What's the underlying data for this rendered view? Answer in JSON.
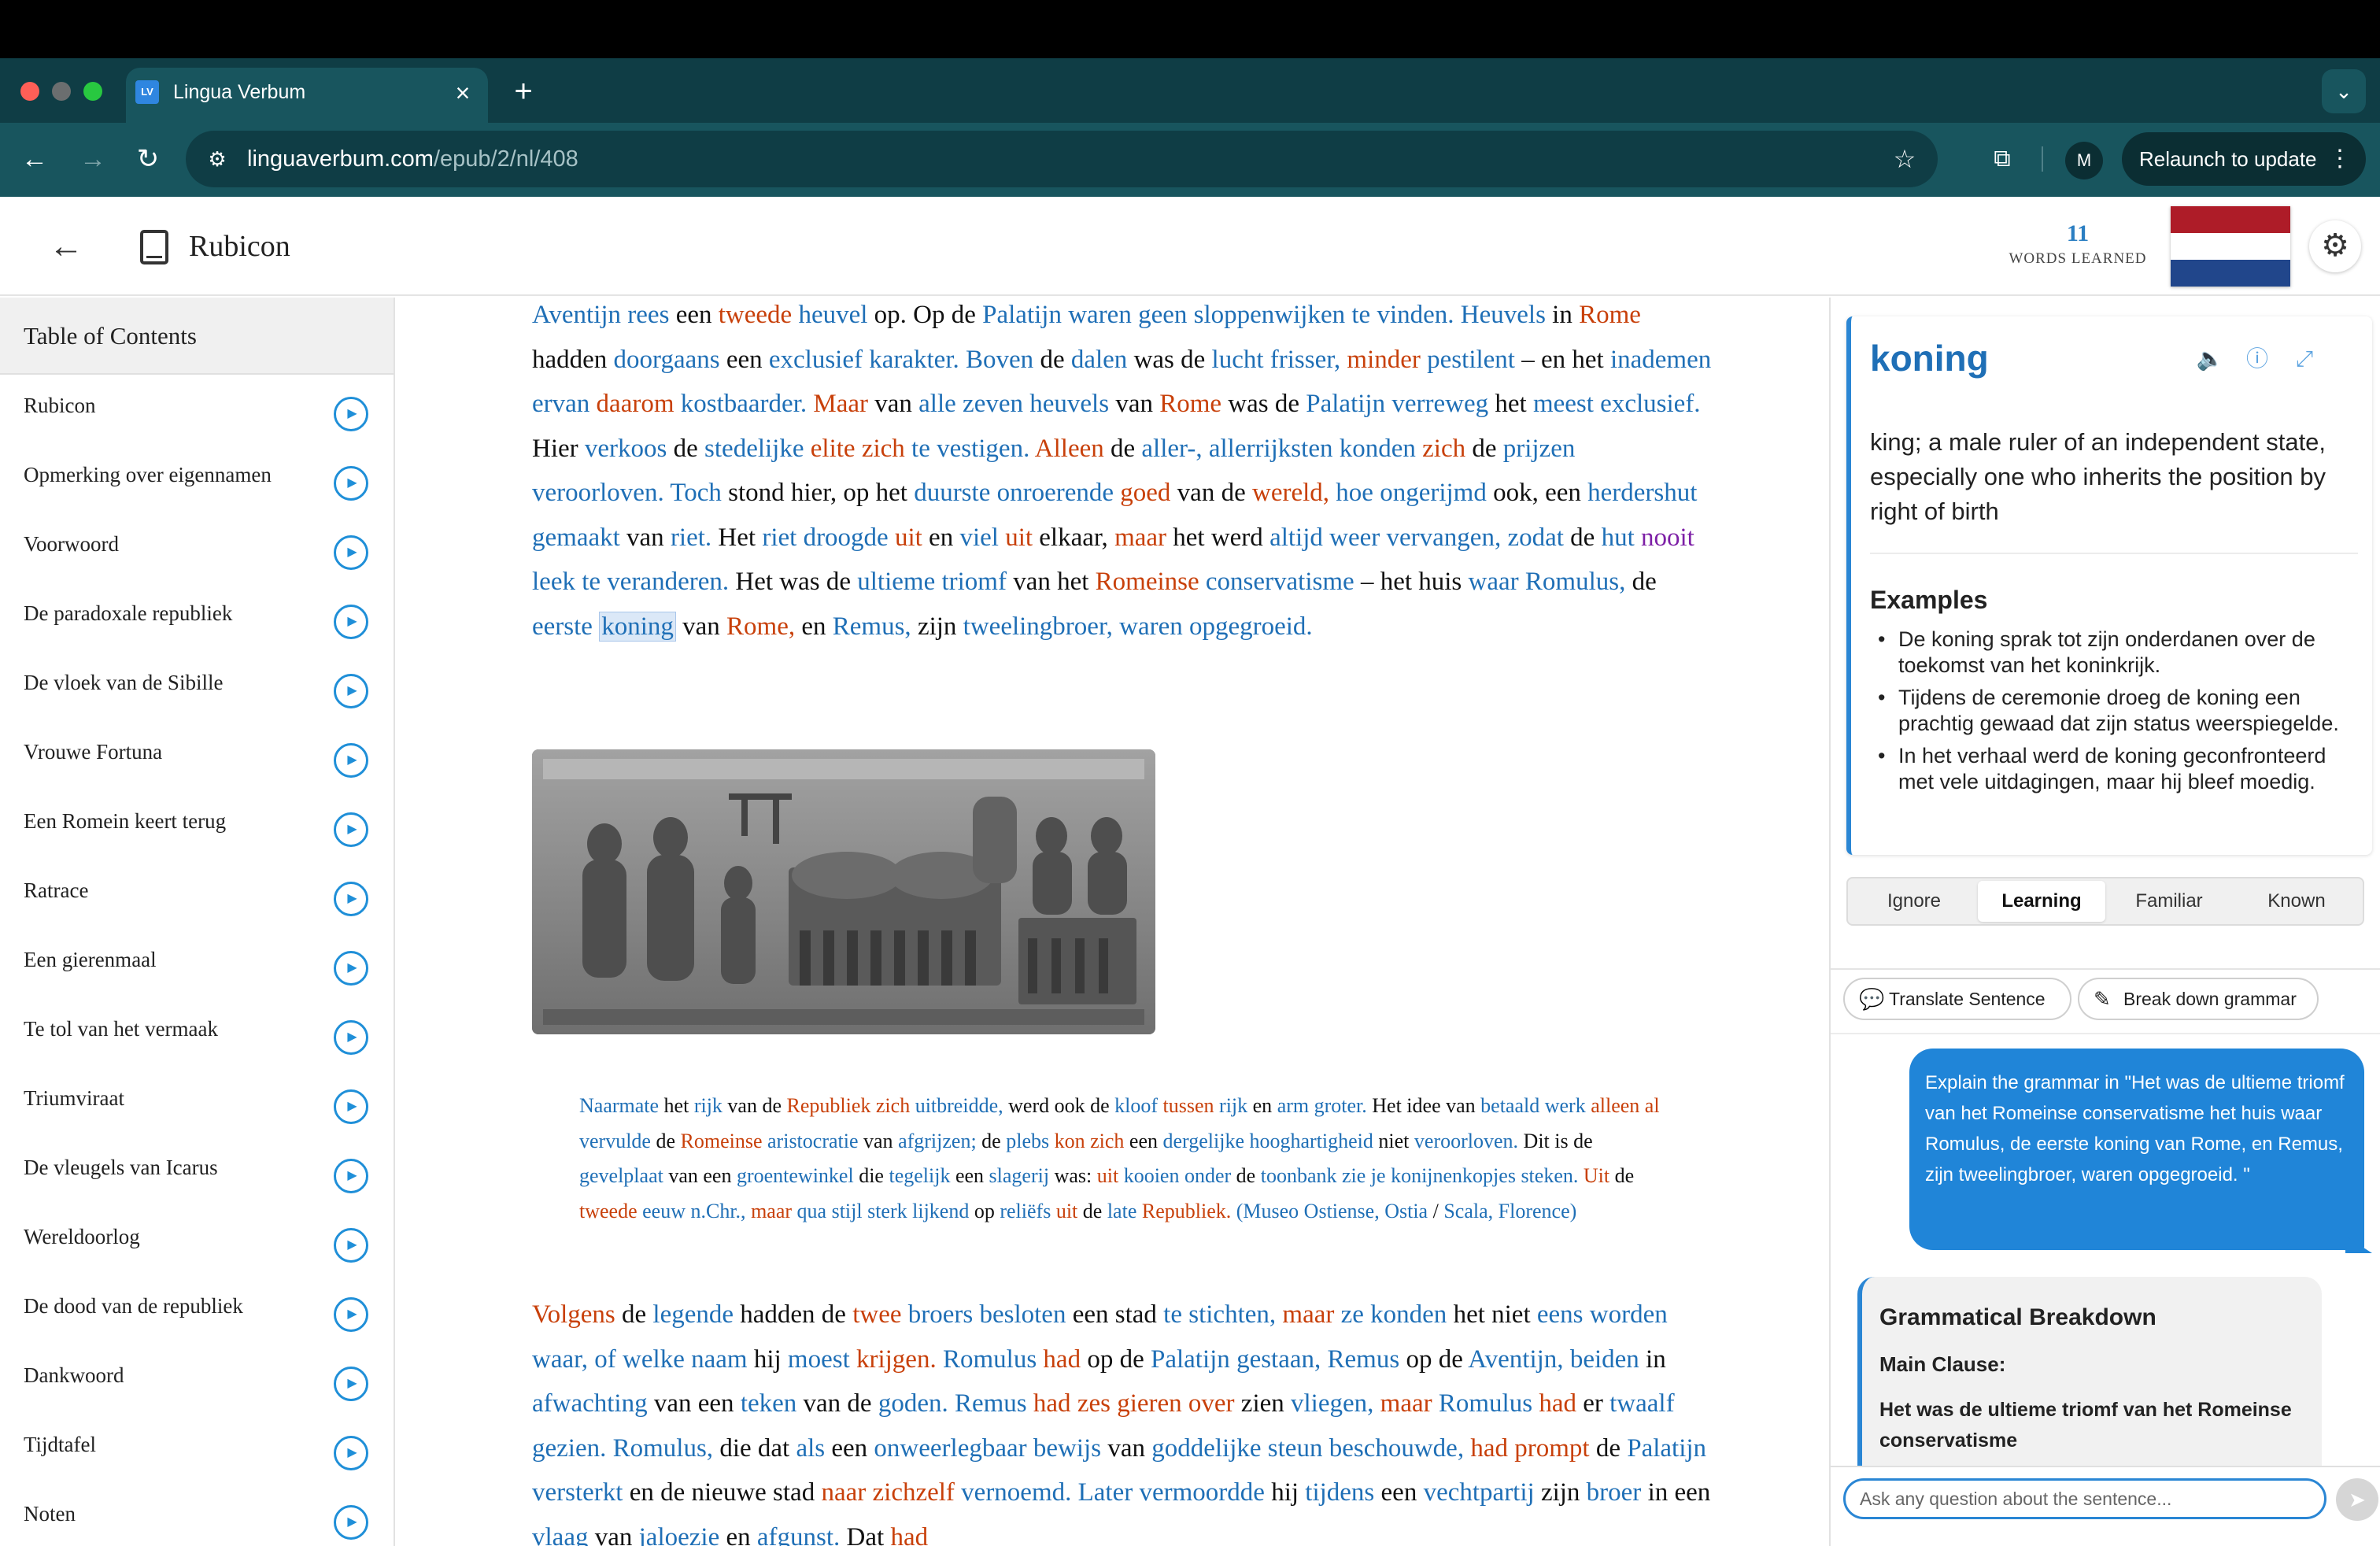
{
  "browser": {
    "tab_title": "Lingua Verbum",
    "tab_favicon": "LV",
    "url_domain": "linguaverbum.com",
    "url_path": "/epub/2/nl/408",
    "profile_initial": "M",
    "relaunch_label": "Relaunch to update"
  },
  "app": {
    "book_title": "Rubicon",
    "words_learned_count": "11",
    "words_learned_label": "WORDS LEARNED",
    "flag_colors": [
      "#ae1c28",
      "#ffffff",
      "#21468b"
    ]
  },
  "toc": {
    "title": "Table of Contents",
    "items": [
      "Rubicon",
      "Opmerking over eigennamen",
      "Voorwoord",
      "De paradoxale republiek",
      "De vloek van de Sibille",
      "Vrouwe Fortuna",
      "Een Romein keert terug",
      "Ratrace",
      "Een gierenmaal",
      "Te tol van het vermaak",
      "Triumviraat",
      "De vleugels van Icarus",
      "Wereldoorlog",
      "De dood van de republiek",
      "Dankwoord",
      "Tijdtafel",
      "Noten"
    ]
  },
  "reader": {
    "para1": [
      [
        "Aventijn",
        "b"
      ],
      [
        " "
      ],
      [
        "rees",
        "b"
      ],
      [
        " een "
      ],
      [
        "tweede",
        "r"
      ],
      [
        " "
      ],
      [
        "heuvel",
        "b"
      ],
      [
        " op. Op de "
      ],
      [
        "Palatijn",
        "b"
      ],
      [
        " "
      ],
      [
        "waren",
        "b"
      ],
      [
        " "
      ],
      [
        "geen",
        "b"
      ],
      [
        " "
      ],
      [
        "sloppenwijken",
        "b"
      ],
      [
        " "
      ],
      [
        "te",
        "b"
      ],
      [
        " "
      ],
      [
        "vinden.",
        "b"
      ],
      [
        " "
      ],
      [
        "Heuvels",
        "b"
      ],
      [
        " in "
      ],
      [
        "Rome",
        "r"
      ],
      [
        " hadden "
      ],
      [
        "doorgaans",
        "b"
      ],
      [
        " een "
      ],
      [
        "exclusief",
        "b"
      ],
      [
        " "
      ],
      [
        "karakter.",
        "b"
      ],
      [
        " "
      ],
      [
        "Boven",
        "b"
      ],
      [
        " de "
      ],
      [
        "dalen",
        "b"
      ],
      [
        " was de "
      ],
      [
        "lucht",
        "b"
      ],
      [
        " "
      ],
      [
        "frisser,",
        "b"
      ],
      [
        " "
      ],
      [
        "minder",
        "r"
      ],
      [
        " "
      ],
      [
        "pestilent",
        "b"
      ],
      [
        " – en het "
      ],
      [
        "inademen",
        "b"
      ],
      [
        " "
      ],
      [
        "ervan",
        "b"
      ],
      [
        " "
      ],
      [
        "daarom",
        "r"
      ],
      [
        " "
      ],
      [
        "kostbaarder.",
        "b"
      ],
      [
        " "
      ],
      [
        "Maar",
        "r"
      ],
      [
        " van "
      ],
      [
        "alle",
        "b"
      ],
      [
        " "
      ],
      [
        "zeven",
        "b"
      ],
      [
        " "
      ],
      [
        "heuvels",
        "b"
      ],
      [
        " van "
      ],
      [
        "Rome",
        "r"
      ],
      [
        " was de "
      ],
      [
        "Palatijn",
        "b"
      ],
      [
        " "
      ],
      [
        "verreweg",
        "b"
      ],
      [
        " het "
      ],
      [
        "meest",
        "b"
      ],
      [
        " "
      ],
      [
        "exclusief.",
        "b"
      ],
      [
        " Hier "
      ],
      [
        "verkoos",
        "b"
      ],
      [
        " de "
      ],
      [
        "stedelijke",
        "b"
      ],
      [
        " "
      ],
      [
        "elite",
        "r"
      ],
      [
        " "
      ],
      [
        "zich",
        "r"
      ],
      [
        " "
      ],
      [
        "te",
        "b"
      ],
      [
        " "
      ],
      [
        "vestigen.",
        "b"
      ],
      [
        " "
      ],
      [
        "Alleen",
        "r"
      ],
      [
        " de "
      ],
      [
        "aller-,",
        "b"
      ],
      [
        " "
      ],
      [
        "allerrijksten",
        "b"
      ],
      [
        " "
      ],
      [
        "konden",
        "b"
      ],
      [
        " "
      ],
      [
        "zich",
        "r"
      ],
      [
        " de "
      ],
      [
        "prijzen",
        "b"
      ],
      [
        " "
      ],
      [
        "veroorloven.",
        "b"
      ],
      [
        " "
      ],
      [
        "Toch",
        "b"
      ],
      [
        " stond hier, op het "
      ],
      [
        "duurste",
        "b"
      ],
      [
        " "
      ],
      [
        "onroerende",
        "b"
      ],
      [
        " "
      ],
      [
        "goed",
        "r"
      ],
      [
        " van "
      ],
      [
        "de "
      ],
      [
        "wereld,",
        "r"
      ],
      [
        " "
      ],
      [
        "hoe",
        "b"
      ],
      [
        " "
      ],
      [
        "ongerijmd",
        "b"
      ],
      [
        " ook, een "
      ],
      [
        "herdershut",
        "b"
      ],
      [
        " "
      ],
      [
        "gemaakt",
        "b"
      ],
      [
        " van "
      ],
      [
        "riet.",
        "b"
      ],
      [
        " Het "
      ],
      [
        "riet",
        "b"
      ],
      [
        " "
      ],
      [
        "droogde",
        "b"
      ],
      [
        " "
      ],
      [
        "uit",
        "r"
      ],
      [
        " en "
      ],
      [
        "viel",
        "b"
      ],
      [
        " "
      ],
      [
        "uit",
        "r"
      ],
      [
        " elkaar, "
      ],
      [
        "maar",
        "r"
      ],
      [
        " het werd "
      ],
      [
        "altijd",
        "b"
      ],
      [
        " "
      ],
      [
        "weer",
        "b"
      ],
      [
        " "
      ],
      [
        "vervangen,",
        "b"
      ],
      [
        " "
      ],
      [
        "zodat",
        "b"
      ],
      [
        " de "
      ],
      [
        "hut",
        "b"
      ],
      [
        " "
      ],
      [
        "nooit",
        "p"
      ],
      [
        " "
      ],
      [
        "leek",
        "b"
      ],
      [
        " "
      ],
      [
        "te",
        "b"
      ],
      [
        " "
      ],
      [
        "veranderen.",
        "b"
      ],
      [
        " Het was de "
      ],
      [
        "ultieme",
        "b"
      ],
      [
        " "
      ],
      [
        "triomf",
        "b"
      ],
      [
        " "
      ],
      [
        "van het "
      ],
      [
        "Romeinse",
        "r"
      ],
      [
        " "
      ],
      [
        "conservatisme",
        "b"
      ],
      [
        " – het huis "
      ],
      [
        "waar",
        "b"
      ],
      [
        " "
      ],
      [
        "Romulus,",
        "b"
      ],
      [
        " de "
      ],
      [
        "eerste",
        "b"
      ],
      [
        " "
      ],
      [
        "koning",
        "sel"
      ],
      [
        " van "
      ],
      [
        "Rome,",
        "r"
      ],
      [
        " en "
      ],
      [
        "Remus,",
        "b"
      ],
      [
        " zijn "
      ],
      [
        "tweelingbroer,",
        "b"
      ],
      [
        " "
      ],
      [
        "waren",
        "b"
      ],
      [
        " "
      ],
      [
        "opgegroeid.",
        "b"
      ]
    ],
    "caption": [
      [
        "Naarmate",
        "b"
      ],
      [
        " het "
      ],
      [
        "rijk",
        "b"
      ],
      [
        " van de "
      ],
      [
        "Republiek",
        "r"
      ],
      [
        " "
      ],
      [
        "zich",
        "r"
      ],
      [
        " "
      ],
      [
        "uitbreidde,",
        "b"
      ],
      [
        " werd ook de "
      ],
      [
        "kloof",
        "b"
      ],
      [
        " "
      ],
      [
        "tussen",
        "r"
      ],
      [
        " "
      ],
      [
        "rijk",
        "b"
      ],
      [
        " en "
      ],
      [
        "arm",
        "b"
      ],
      [
        " "
      ],
      [
        "groter.",
        "b"
      ],
      [
        " Het idee van "
      ],
      [
        "betaald",
        "b"
      ],
      [
        " "
      ],
      [
        "werk",
        "b"
      ],
      [
        " "
      ],
      [
        "alleen",
        "r"
      ],
      [
        " "
      ],
      [
        "al",
        "r"
      ],
      [
        " "
      ],
      [
        "vervulde",
        "b"
      ],
      [
        " de "
      ],
      [
        "Romeinse",
        "r"
      ],
      [
        " "
      ],
      [
        "aristocratie",
        "b"
      ],
      [
        " van "
      ],
      [
        "afgrijzen;",
        "b"
      ],
      [
        " de "
      ],
      [
        "plebs",
        "b"
      ],
      [
        " "
      ],
      [
        "kon",
        "r"
      ],
      [
        " "
      ],
      [
        "zich",
        "r"
      ],
      [
        " een "
      ],
      [
        "dergelijke",
        "b"
      ],
      [
        " "
      ],
      [
        "hooghartigheid",
        "b"
      ],
      [
        " niet "
      ],
      [
        "veroorloven.",
        "b"
      ],
      [
        " "
      ],
      [
        "Dit is de "
      ],
      [
        "gevelplaat",
        "b"
      ],
      [
        " van een "
      ],
      [
        "groentewinkel",
        "b"
      ],
      [
        " die "
      ],
      [
        "tegelijk",
        "b"
      ],
      [
        " een "
      ],
      [
        "slagerij",
        "b"
      ],
      [
        " was: "
      ],
      [
        "uit",
        "r"
      ],
      [
        " "
      ],
      [
        "kooien",
        "b"
      ],
      [
        " "
      ],
      [
        "onder",
        "b"
      ],
      [
        " de "
      ],
      [
        "toonbank",
        "b"
      ],
      [
        " "
      ],
      [
        "zie",
        "b"
      ],
      [
        " "
      ],
      [
        "je",
        "b"
      ],
      [
        " "
      ],
      [
        "konijnenkopjes",
        "b"
      ],
      [
        " "
      ],
      [
        "steken.",
        "b"
      ],
      [
        " "
      ],
      [
        "Uit",
        "r"
      ],
      [
        " de "
      ],
      [
        "tweede",
        "r"
      ],
      [
        " "
      ],
      [
        "eeuw",
        "b"
      ],
      [
        " "
      ],
      [
        "n.Chr.,",
        "b"
      ],
      [
        " "
      ],
      [
        "maar",
        "r"
      ],
      [
        " "
      ],
      [
        "qua",
        "b"
      ],
      [
        " "
      ],
      [
        "stijl",
        "b"
      ],
      [
        " "
      ],
      [
        "sterk",
        "b"
      ],
      [
        " "
      ],
      [
        "lijkend",
        "b"
      ],
      [
        " op "
      ],
      [
        "reliëfs",
        "b"
      ],
      [
        " "
      ],
      [
        "uit",
        "r"
      ],
      [
        " de "
      ],
      [
        "late",
        "b"
      ],
      [
        " "
      ],
      [
        "Republiek.",
        "r"
      ],
      [
        " "
      ],
      [
        "(Museo",
        "b"
      ],
      [
        " "
      ],
      [
        "Ostiense,",
        "b"
      ],
      [
        " "
      ],
      [
        "Ostia",
        "b"
      ],
      [
        " / "
      ],
      [
        "Scala,",
        "b"
      ],
      [
        " "
      ],
      [
        "Florence)",
        "b"
      ]
    ],
    "para2": [
      [
        "Volgens",
        "r"
      ],
      [
        " de "
      ],
      [
        "legende",
        "b"
      ],
      [
        " hadden de "
      ],
      [
        "twee",
        "r"
      ],
      [
        " "
      ],
      [
        "broers",
        "b"
      ],
      [
        " "
      ],
      [
        "besloten",
        "b"
      ],
      [
        " een stad "
      ],
      [
        "te",
        "b"
      ],
      [
        " "
      ],
      [
        "stichten,",
        "b"
      ],
      [
        " "
      ],
      [
        "maar",
        "r"
      ],
      [
        " "
      ],
      [
        "ze",
        "b"
      ],
      [
        " "
      ],
      [
        "konden",
        "b"
      ],
      [
        " het niet "
      ],
      [
        "eens",
        "b"
      ],
      [
        " "
      ],
      [
        "worden",
        "b"
      ],
      [
        " "
      ],
      [
        "waar,",
        "b"
      ],
      [
        " "
      ],
      [
        "of",
        "b"
      ],
      [
        " "
      ],
      [
        "welke",
        "b"
      ],
      [
        " "
      ],
      [
        "naam",
        "b"
      ],
      [
        " hij "
      ],
      [
        "moest",
        "b"
      ],
      [
        " "
      ],
      [
        "krijgen.",
        "r"
      ],
      [
        " "
      ],
      [
        "Romulus",
        "b"
      ],
      [
        " "
      ],
      [
        "had",
        "r"
      ],
      [
        " op de "
      ],
      [
        "Palatijn",
        "b"
      ],
      [
        " "
      ],
      [
        "gestaan,",
        "b"
      ],
      [
        " "
      ],
      [
        "Remus",
        "b"
      ],
      [
        " op de "
      ],
      [
        "Aventijn,",
        "b"
      ],
      [
        " "
      ],
      [
        "beiden",
        "b"
      ],
      [
        " in "
      ],
      [
        "afwachting",
        "b"
      ],
      [
        " van een "
      ],
      [
        "teken",
        "b"
      ],
      [
        " van de "
      ],
      [
        "goden.",
        "b"
      ],
      [
        " "
      ],
      [
        "Remus",
        "b"
      ],
      [
        " "
      ],
      [
        "had",
        "r"
      ],
      [
        " "
      ],
      [
        "zes",
        "r"
      ],
      [
        " "
      ],
      [
        "gieren",
        "r"
      ],
      [
        " "
      ],
      [
        "over",
        "r"
      ],
      [
        " zien "
      ],
      [
        "vliegen,",
        "b"
      ],
      [
        " "
      ],
      [
        "maar",
        "r"
      ],
      [
        " "
      ],
      [
        "Romulus",
        "b"
      ],
      [
        " "
      ],
      [
        "had",
        "r"
      ],
      [
        " er "
      ],
      [
        "twaalf",
        "b"
      ],
      [
        " "
      ],
      [
        "gezien.",
        "b"
      ],
      [
        " "
      ],
      [
        "Romulus,",
        "b"
      ],
      [
        " die dat "
      ],
      [
        "als",
        "b"
      ],
      [
        " een "
      ],
      [
        "onweerlegbaar",
        "b"
      ],
      [
        " "
      ],
      [
        "bewijs",
        "b"
      ],
      [
        " van "
      ],
      [
        "goddelijke",
        "b"
      ],
      [
        " "
      ],
      [
        "steun",
        "b"
      ],
      [
        " "
      ],
      [
        "beschouwde,",
        "b"
      ],
      [
        " "
      ],
      [
        "had",
        "r"
      ],
      [
        " "
      ],
      [
        "prompt",
        "r"
      ],
      [
        " de "
      ],
      [
        "Palatijn",
        "b"
      ],
      [
        " "
      ],
      [
        "versterkt",
        "b"
      ],
      [
        " en de nieuwe stad "
      ],
      [
        "naar",
        "r"
      ],
      [
        " "
      ],
      [
        "zichzelf",
        "r"
      ],
      [
        " "
      ],
      [
        "vernoemd.",
        "b"
      ],
      [
        " "
      ],
      [
        "Later",
        "b"
      ],
      [
        " "
      ],
      [
        "vermoordde",
        "b"
      ],
      [
        " hij "
      ],
      [
        "tijdens",
        "b"
      ],
      [
        " een "
      ],
      [
        "vechtpartij",
        "b"
      ],
      [
        " zijn "
      ],
      [
        "broer",
        "b"
      ],
      [
        " in een "
      ],
      [
        "vlaag",
        "b"
      ],
      [
        " van "
      ],
      [
        "jaloezie",
        "b"
      ],
      [
        " en "
      ],
      [
        "afgunst.",
        "b"
      ],
      [
        " Dat "
      ],
      [
        "had",
        "r"
      ]
    ]
  },
  "word_panel": {
    "word": "koning",
    "definition": "king; a male ruler of an independent state, especially one who inherits the position by right of birth",
    "examples_title": "Examples",
    "examples": [
      "De koning sprak tot zijn onderdanen over de toekomst van het koninkrijk.",
      "Tijdens de ceremonie droeg de koning een prachtig gewaad dat zijn status weerspiegelde.",
      "In het verhaal werd de koning geconfronteerd met vele uitdagingen, maar hij bleef moedig."
    ],
    "levels": [
      "Ignore",
      "Learning",
      "Familiar",
      "Known"
    ],
    "active_level": "Learning",
    "translate_label": "Translate Sentence",
    "grammar_label": "Break down grammar"
  },
  "chat": {
    "user_message": "Explain the grammar in \"Het was de ultieme triomf van het Romeinse conservatisme het huis waar Romulus, de eerste koning van Rome, en Remus, zijn tweelingbroer, waren opgegroeid. \"",
    "bd_title": "Grammatical Breakdown",
    "bd_main": "Main Clause:",
    "bd_sentence": "Het was de ultieme triomf van het Romeinse conservatisme",
    "input_placeholder": "Ask any question about the sentence..."
  },
  "colors": {
    "chrome_dark": "#0f3d45",
    "chrome_mid": "#18555e",
    "known_word": "#1f6fb6",
    "new_word": "#c8400a",
    "accent": "#2a86d4"
  }
}
